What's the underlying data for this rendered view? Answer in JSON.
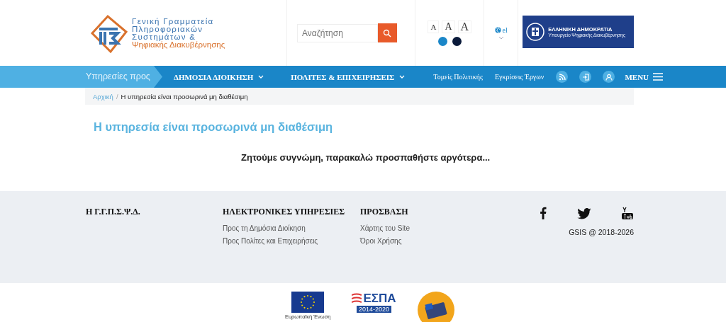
{
  "header": {
    "logo_lines": [
      "Γενική Γραμματεία",
      "Πληροφοριακών",
      "Συστημάτων &",
      "Ψηφιακής Διακυβέρνησης"
    ],
    "search": {
      "placeholder": "Αναζήτηση"
    },
    "font_sizes": [
      {
        "label": "A"
      },
      {
        "label": "A"
      },
      {
        "label": "A"
      }
    ],
    "themes": [
      {
        "color": "#1a86c8"
      },
      {
        "color": "#0a1a3a"
      }
    ],
    "language": "el",
    "republic": {
      "title": "ΕΛΛΗΝΙΚΗ ΔΗΜΟΚΡΑΤΙΑ",
      "subtitle": "Υπουργείο Ψηφιακής Διακυβέρνησης"
    }
  },
  "nav": {
    "lead": "Υπηρεσίες προς",
    "items": [
      {
        "label": "ΔΗΜΟΣΙΑ ΔΙΟΙΚΗΣΗ",
        "kind": "dropdown"
      },
      {
        "label": "ΠΟΛΙΤΕΣ & ΕΠΙΧΕΙΡΗΣΕΙΣ",
        "kind": "dropdown"
      },
      {
        "label": "Τομείς Πολιτικής",
        "kind": "link"
      },
      {
        "label": "Εγκρίσεις Έργων",
        "kind": "link"
      }
    ],
    "menu": "MENU"
  },
  "breadcrumb": {
    "separator": "/",
    "items": [
      {
        "label": "Αρχική",
        "kind": "link"
      },
      {
        "label": "Η υπηρεσία είναι προσωρινά μη διαθέσιμη",
        "kind": "current"
      }
    ]
  },
  "page_title": "Η υπηρεσία είναι προσωρινά μη διαθέσιμη",
  "message": "Ζητούμε συγνώμη, παρακαλώ προσπαθήστε αργότερα...",
  "footer": {
    "columns": [
      {
        "heading": "Η Γ.Γ.Π.Σ.Ψ.Δ."
      },
      {
        "heading": "ΗΛΕΚΤΡΟΝΙΚΕΣ ΥΠΗΡΕΣΙΕΣ",
        "links": [
          "Προς τη Δημόσια Διοίκηση",
          "Προς Πολίτες και Επιχειρήσεις"
        ]
      },
      {
        "heading": "ΠΡΟΣΒΑΣΗ",
        "links": [
          "Χάρτης του Site",
          "Όροι Χρήσης"
        ]
      }
    ],
    "social": [
      {
        "kind": "facebook"
      },
      {
        "kind": "twitter"
      },
      {
        "kind": "youtube"
      }
    ],
    "copyright": "GSIS @ 2018-2026"
  },
  "sponsors": {
    "eu": "Ευρωπαϊκή Ένωση",
    "espa": "ΕΣΠΑ",
    "espa_years": "2014-2020"
  }
}
